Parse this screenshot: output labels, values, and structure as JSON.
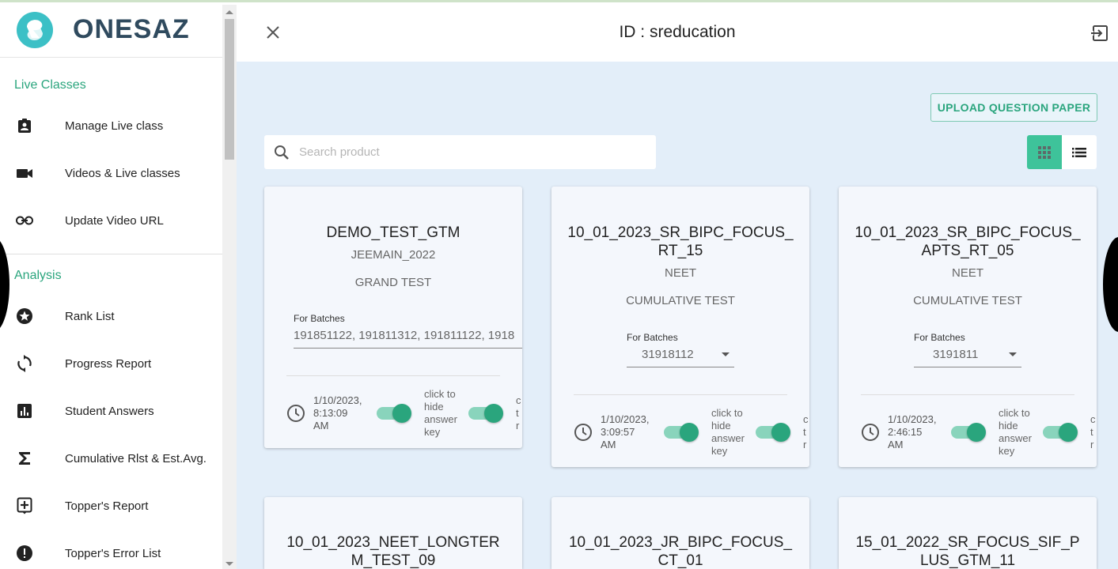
{
  "app": {
    "name": "ONESAZ"
  },
  "header": {
    "title": "ID : sreducation"
  },
  "sidebar": {
    "sections": [
      {
        "title": "Live Classes",
        "items": [
          {
            "label": "Manage Live class",
            "icon": "clipboard-account-icon"
          },
          {
            "label": "Videos & Live classes",
            "icon": "videocam-icon"
          },
          {
            "label": "Update Video URL",
            "icon": "link-icon"
          }
        ]
      },
      {
        "title": "Analysis",
        "items": [
          {
            "label": "Rank List",
            "icon": "star-circle-icon"
          },
          {
            "label": "Progress Report",
            "icon": "refresh-icon"
          },
          {
            "label": "Student Answers",
            "icon": "bar-chart-icon"
          },
          {
            "label": "Cumulative Rlst & Est.Avg.",
            "icon": "sigma-icon"
          },
          {
            "label": "Topper's Report",
            "icon": "add-box-icon"
          },
          {
            "label": "Topper's Error List",
            "icon": "alert-circle-icon"
          }
        ]
      }
    ]
  },
  "toolbar": {
    "upload_label": "UPLOAD QUESTION PAPER",
    "search_placeholder": "Search product",
    "view_mode": "grid"
  },
  "cards": [
    {
      "title": "DEMO_TEST_GTM",
      "exam": "JEEMAIN_2022",
      "type": "GRAND TEST",
      "batch_label": "For Batches",
      "batches": "191851122, 191811312, 191811122, 1918",
      "date_line1": "1/10/2023,",
      "date_line2": "8:13:09",
      "date_line3": "AM",
      "toggle1_on": true,
      "caption": [
        "click to",
        "hide",
        "answer",
        "key"
      ],
      "cut": [
        "c",
        "t",
        "r"
      ]
    },
    {
      "title": "10_01_2023_SR_BIPC_FOCUS_RT_15",
      "exam": "NEET",
      "type": "CUMULATIVE TEST",
      "batch_label": "For Batches",
      "batches": "31918112",
      "date_line1": "1/10/2023,",
      "date_line2": "3:09:57",
      "date_line3": "AM",
      "toggle1_on": true,
      "caption": [
        "click to",
        "hide",
        "answer",
        "key"
      ],
      "cut": [
        "c",
        "t",
        "r"
      ]
    },
    {
      "title": "10_01_2023_SR_BIPC_FOCUS_APTS_RT_05",
      "exam": "NEET",
      "type": "CUMULATIVE TEST",
      "batch_label": "For Batches",
      "batches": "3191811",
      "date_line1": "1/10/2023,",
      "date_line2": "2:46:15",
      "date_line3": "AM",
      "toggle1_on": true,
      "caption": [
        "click to",
        "hide",
        "answer",
        "key"
      ],
      "cut": [
        "c",
        "t",
        "r"
      ]
    },
    {
      "title": "10_01_2023_NEET_LONGTERM_TEST_09"
    },
    {
      "title": "10_01_2023_JR_BIPC_FOCUS_CT_01"
    },
    {
      "title": "15_01_2022_SR_FOCUS_SIF_PLUS_GTM_11"
    }
  ],
  "colors": {
    "accent": "#2aa57d",
    "toggle_active": "#3ec39a",
    "background": "#e3eef9"
  }
}
